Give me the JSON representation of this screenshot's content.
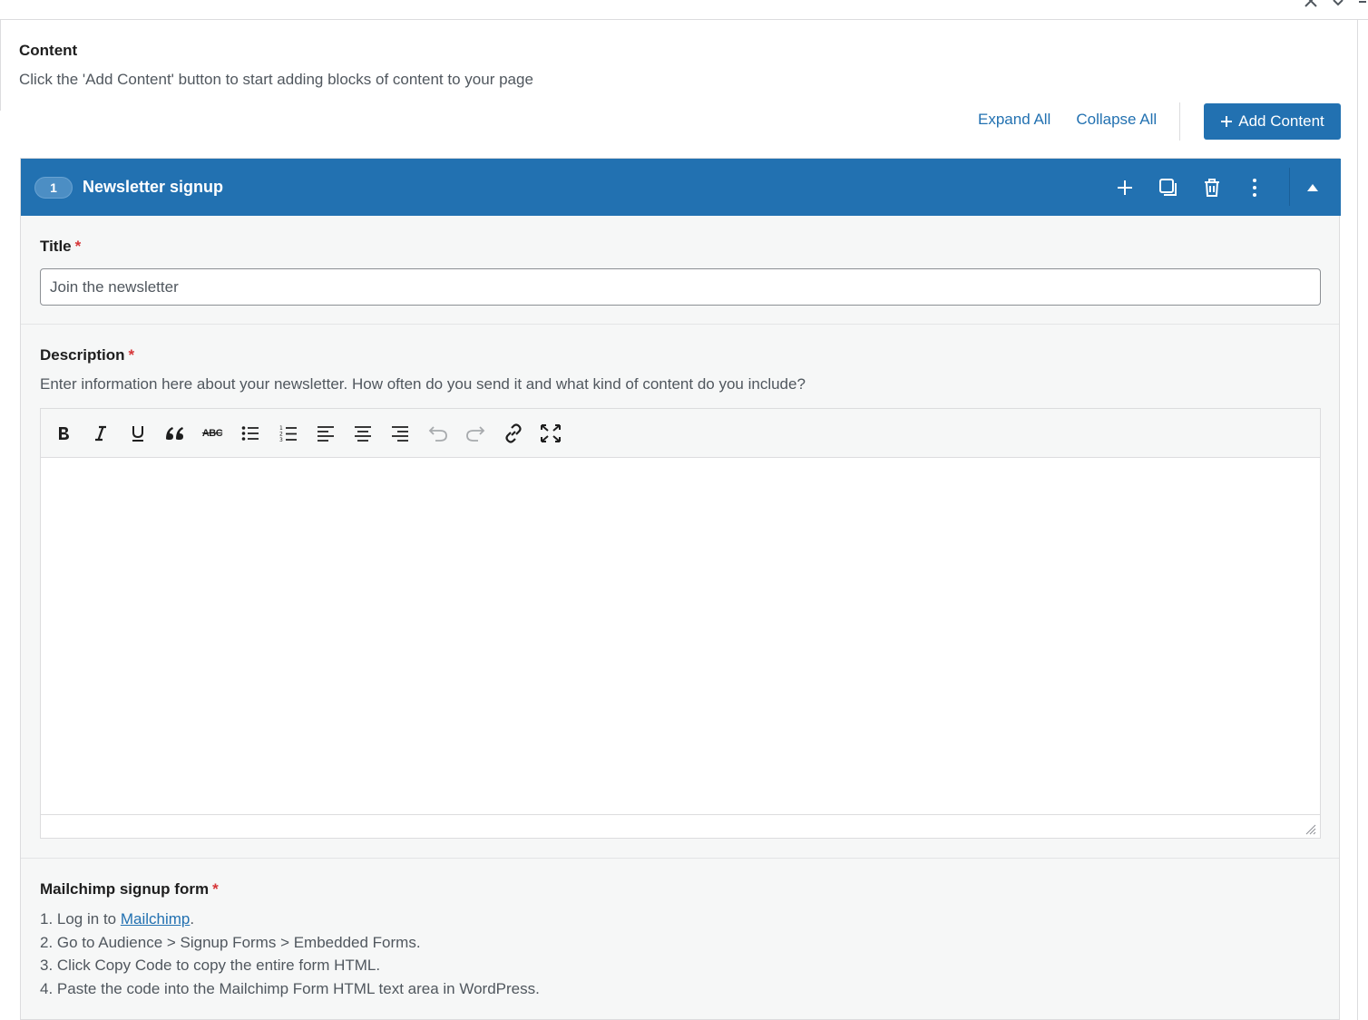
{
  "content": {
    "heading": "Content",
    "description": "Click the 'Add Content' button to start adding blocks of content to your page",
    "expand_all": "Expand All",
    "collapse_all": "Collapse All",
    "add_content_label": "Add Content"
  },
  "block": {
    "number": "1",
    "title": "Newsletter signup",
    "accent_color": "#2271b1"
  },
  "title_field": {
    "label": "Title",
    "required_mark": "*",
    "value": "Join the newsletter"
  },
  "description_field": {
    "label": "Description",
    "required_mark": "*",
    "help": "Enter information here about your newsletter. How often do you send it and what kind of content do you include?",
    "toolbar": [
      "bold-icon",
      "italic-icon",
      "underline-icon",
      "blockquote-icon",
      "strikethrough-icon",
      "bullet-list-icon",
      "numbered-list-icon",
      "align-left-icon",
      "align-center-icon",
      "align-right-icon",
      "undo-icon",
      "redo-icon",
      "link-icon",
      "fullscreen-icon"
    ],
    "strikethrough_text": "ABC"
  },
  "mailchimp_field": {
    "label": "Mailchimp signup form",
    "required_mark": "*",
    "step1_prefix": "1. Log in to ",
    "step1_link": "Mailchimp",
    "step1_suffix": ".",
    "step2": "2. Go to Audience > Signup Forms > Embedded Forms.",
    "step3": "3. Click Copy Code to copy the entire form HTML.",
    "step4": "4. Paste the code into the Mailchimp Form HTML text area in WordPress."
  }
}
